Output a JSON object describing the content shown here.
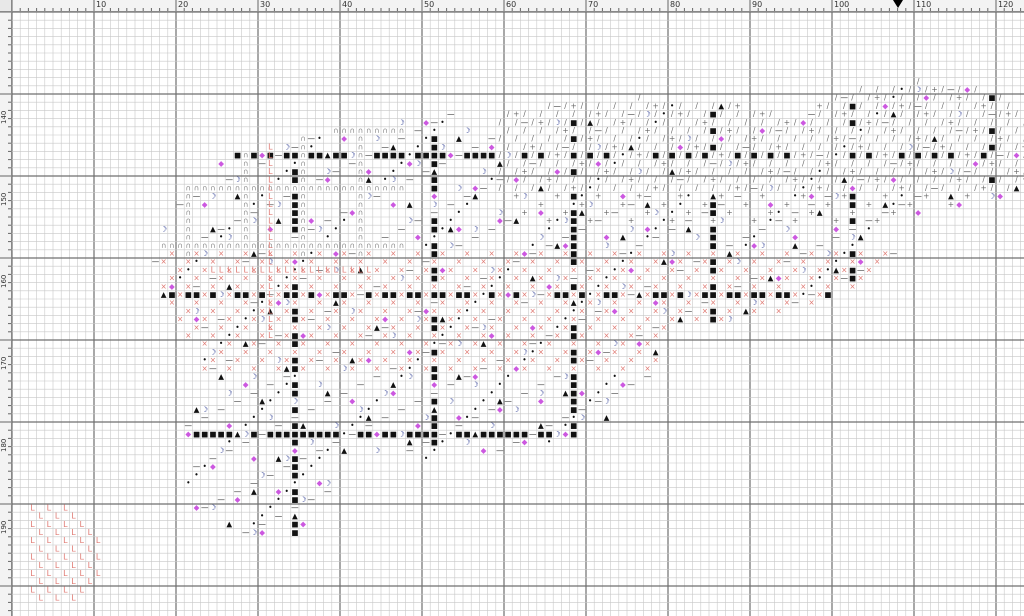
{
  "window": {
    "title": ""
  },
  "rulers": {
    "horizontal_labels": [
      "10",
      "20",
      "30",
      "40",
      "50",
      "60",
      "70",
      "80",
      "90",
      "100",
      "110",
      "120"
    ],
    "vertical_labels": [
      "140",
      "150",
      "160",
      "170",
      "180",
      "190"
    ]
  },
  "symbols": {
    "x": "×",
    "l": "L",
    "dash": "—",
    "plus": "+",
    "slash": "/",
    "arch": "∩",
    "crescent": "☽",
    "tri": "▲",
    "diamond": "◆",
    "block": "■",
    "dot": "•"
  },
  "colors": {
    "pink": "#e07b74",
    "magenta": "#cc58e0",
    "gray": "#666666",
    "black": "#000000",
    "navy": "#1c2d8a",
    "grid_minor": "#c8c8c8",
    "grid_major": "#6f6f6f"
  }
}
